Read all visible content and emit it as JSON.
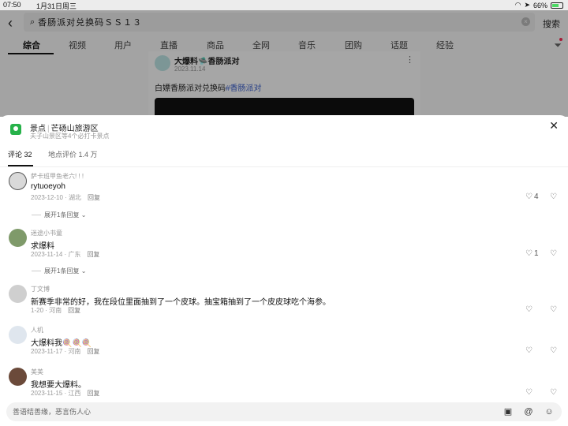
{
  "status": {
    "time": "07:50",
    "date": "1月31日周三",
    "battery": "66%"
  },
  "search": {
    "query": "香肠派对兑换码ＳＳ１３",
    "button": "搜索"
  },
  "tabs": [
    {
      "label": "综合",
      "active": true
    },
    {
      "label": "视频"
    },
    {
      "label": "用户"
    },
    {
      "label": "直播"
    },
    {
      "label": "商品"
    },
    {
      "label": "全网"
    },
    {
      "label": "音乐"
    },
    {
      "label": "团购"
    },
    {
      "label": "话题"
    },
    {
      "label": "经验"
    }
  ],
  "card": {
    "author": "大爆料🛸香肠派对",
    "date": "2023.11.14",
    "title_prefix": "白嫖香肠派对兑换码",
    "title_tag": "#香肠派对"
  },
  "sheet": {
    "category": "景点",
    "place": "芒砀山旅游区",
    "subtitle": "夫子山景区等4个必打卡景点",
    "tabs": [
      {
        "label": "评论 32",
        "active": true
      },
      {
        "label": "地点评价 1.4 万"
      }
    ]
  },
  "comments": [
    {
      "name": "萨卡班甲鱼老六! ! !",
      "text": "rytuoeyoh",
      "date": "2023-12-10 · 湖北",
      "reply": "回复",
      "likes": "4",
      "expand": "展开1条回复",
      "avatar_color": "#d9d9d9"
    },
    {
      "name": "迷途小书童",
      "text": "求爆料",
      "date": "2023-11-14 · 广东",
      "reply": "回复",
      "likes": "1",
      "expand": "展开1条回复",
      "avatar_color": "#7f9a6a"
    },
    {
      "name": "丁文博",
      "text": "新赛季非常的好，我在段位里面抽到了一个皮球。抽宝箱抽到了一个皮皮球吃个海参。",
      "date": "1-20 · 河南",
      "reply": "回复",
      "likes": "",
      "expand": "",
      "avatar_color": "#cfcfcf"
    },
    {
      "name": "人机",
      "text": "大爆料我🍭🍭🍭",
      "date": "2023-11-17 · 河南",
      "reply": "回复",
      "likes": "",
      "expand": "",
      "avatar_color": "#dfe6ee"
    },
    {
      "name": "美美",
      "text": "我想要大爆料。",
      "date": "2023-11-15 · 江西",
      "reply": "回复",
      "likes": "",
      "expand": "",
      "avatar_color": "#6b4a3a"
    }
  ],
  "input": {
    "placeholder": "善语结善缘，恶言伤人心"
  }
}
